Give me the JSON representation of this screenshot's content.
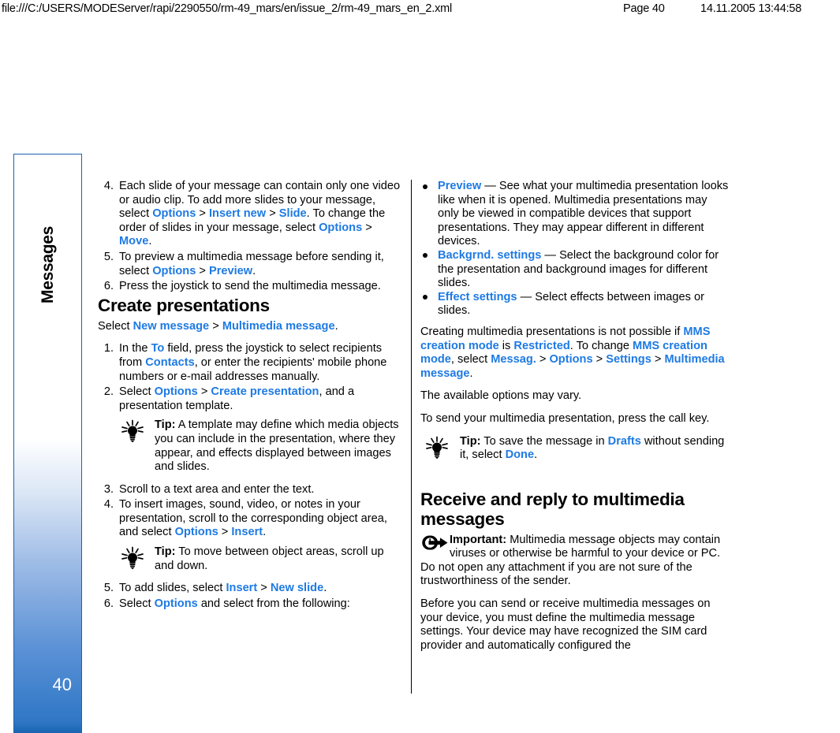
{
  "print_header": {
    "file_path": "file:///C:/USERS/MODEServer/rapi/2290550/rm-49_mars/en/issue_2/rm-49_mars_en_2.xml",
    "page_label": "Page 40",
    "timestamp": "14.11.2005 13:44:58"
  },
  "side_tab": {
    "chapter": "Messages",
    "page_number": "40",
    "border_color": "#1c63ac",
    "gradient_end_color": "#1763ae"
  },
  "colors": {
    "link_blue": "#1e7ae3",
    "text_black": "#000000",
    "page_background": "#ffffff"
  },
  "left_column": {
    "continued_steps": [
      {
        "num": "4.",
        "runs": [
          {
            "t": "Each slide of your message can contain only one video or audio clip. To add more slides to your message, select ",
            "s": "plain"
          },
          {
            "t": "Options",
            "s": "link"
          },
          {
            "t": " > ",
            "s": "gt"
          },
          {
            "t": "Insert new",
            "s": "link"
          },
          {
            "t": " > ",
            "s": "gt"
          },
          {
            "t": "Slide",
            "s": "link"
          },
          {
            "t": ". To change the order of slides in your message, select ",
            "s": "plain"
          },
          {
            "t": "Options",
            "s": "link"
          },
          {
            "t": " > ",
            "s": "gt"
          },
          {
            "t": "Move",
            "s": "link"
          },
          {
            "t": ".",
            "s": "plain"
          }
        ]
      },
      {
        "num": "5.",
        "runs": [
          {
            "t": "To preview a multimedia message before sending it, select ",
            "s": "plain"
          },
          {
            "t": "Options",
            "s": "link"
          },
          {
            "t": " > ",
            "s": "gt"
          },
          {
            "t": "Preview",
            "s": "link"
          },
          {
            "t": ".",
            "s": "plain"
          }
        ]
      },
      {
        "num": "6.",
        "runs": [
          {
            "t": "Press the joystick to send the multimedia message.",
            "s": "plain"
          }
        ]
      }
    ],
    "heading": "Create presentations",
    "intro": {
      "runs": [
        {
          "t": "Select ",
          "s": "plain"
        },
        {
          "t": "New message",
          "s": "link"
        },
        {
          "t": " > ",
          "s": "gt"
        },
        {
          "t": "Multimedia message",
          "s": "link"
        },
        {
          "t": ".",
          "s": "plain"
        }
      ]
    },
    "steps_a": [
      {
        "num": "1.",
        "runs": [
          {
            "t": "In the ",
            "s": "plain"
          },
          {
            "t": "To",
            "s": "link"
          },
          {
            "t": " field, press the joystick to select recipients from ",
            "s": "plain"
          },
          {
            "t": "Contacts",
            "s": "link"
          },
          {
            "t": ", or enter the recipients' mobile phone numbers or e-mail addresses manually.",
            "s": "plain"
          }
        ]
      },
      {
        "num": "2.",
        "runs": [
          {
            "t": "Select ",
            "s": "plain"
          },
          {
            "t": "Options",
            "s": "link"
          },
          {
            "t": " > ",
            "s": "gt"
          },
          {
            "t": "Create presentation",
            "s": "link"
          },
          {
            "t": ", and a presentation template.",
            "s": "plain"
          }
        ]
      }
    ],
    "tip_1": {
      "icon": "lightbulb-icon",
      "label": "Tip:",
      "text": " A template may define which media objects you can include in the presentation, where they appear, and effects displayed between images and slides."
    },
    "steps_b": [
      {
        "num": "3.",
        "runs": [
          {
            "t": "Scroll to a text area and enter the text.",
            "s": "plain"
          }
        ]
      },
      {
        "num": "4.",
        "runs": [
          {
            "t": "To insert images, sound, video, or notes in your presentation, scroll to the corresponding object area, and select ",
            "s": "plain"
          },
          {
            "t": "Options",
            "s": "link"
          },
          {
            "t": " > ",
            "s": "gt"
          },
          {
            "t": "Insert",
            "s": "link"
          },
          {
            "t": ".",
            "s": "plain"
          }
        ]
      }
    ],
    "tip_2": {
      "icon": "lightbulb-icon",
      "label": "Tip:",
      "text": " To move between object areas, scroll up and down."
    },
    "steps_c": [
      {
        "num": "5.",
        "runs": [
          {
            "t": "To add slides, select ",
            "s": "plain"
          },
          {
            "t": "Insert",
            "s": "link"
          },
          {
            "t": " > ",
            "s": "gt"
          },
          {
            "t": "New slide",
            "s": "link"
          },
          {
            "t": ".",
            "s": "plain"
          }
        ]
      },
      {
        "num": "6.",
        "runs": [
          {
            "t": "Select ",
            "s": "plain"
          },
          {
            "t": "Options",
            "s": "link"
          },
          {
            "t": " and select from the following:",
            "s": "plain"
          }
        ]
      }
    ]
  },
  "right_column": {
    "bullets": [
      {
        "runs": [
          {
            "t": "Preview",
            "s": "link"
          },
          {
            "t": " — See what your multimedia presentation looks like when it is opened. Multimedia presentations may only be viewed in compatible devices that support presentations. They may appear different in different devices.",
            "s": "plain"
          }
        ]
      },
      {
        "runs": [
          {
            "t": "Backgrnd. settings",
            "s": "link"
          },
          {
            "t": " — Select the background color for the presentation and background images for different slides.",
            "s": "plain"
          }
        ]
      },
      {
        "runs": [
          {
            "t": "Effect settings",
            "s": "link"
          },
          {
            "t": " — Select effects between images or slides.",
            "s": "plain"
          }
        ]
      }
    ],
    "para_creating": {
      "runs": [
        {
          "t": "Creating multimedia presentations is not possible if ",
          "s": "plain"
        },
        {
          "t": "MMS creation mode",
          "s": "link"
        },
        {
          "t": " is ",
          "s": "plain"
        },
        {
          "t": "Restricted",
          "s": "link"
        },
        {
          "t": ". To change ",
          "s": "plain"
        },
        {
          "t": "MMS creation mode",
          "s": "link"
        },
        {
          "t": ", select ",
          "s": "plain"
        },
        {
          "t": "Messag.",
          "s": "link"
        },
        {
          "t": " > ",
          "s": "gt"
        },
        {
          "t": "Options",
          "s": "link"
        },
        {
          "t": " > ",
          "s": "gt"
        },
        {
          "t": "Settings",
          "s": "link"
        },
        {
          "t": " > ",
          "s": "gt"
        },
        {
          "t": "Multimedia message",
          "s": "link"
        },
        {
          "t": ".",
          "s": "plain"
        }
      ]
    },
    "para_options_vary": "The available options may vary.",
    "para_send": "To send your multimedia presentation, press the call key.",
    "tip_3": {
      "icon": "lightbulb-icon",
      "label": "Tip:",
      "runs": [
        {
          "t": " To save the message in ",
          "s": "plain"
        },
        {
          "t": "Drafts",
          "s": "link"
        },
        {
          "t": " without sending it, select ",
          "s": "plain"
        },
        {
          "t": "Done",
          "s": "link"
        },
        {
          "t": ".",
          "s": "plain"
        }
      ]
    },
    "heading": "Receive and reply to multimedia messages",
    "important": {
      "icon": "important-arrow-icon",
      "label": "Important:",
      "text": "  Multimedia message objects may contain viruses or otherwise be harmful to your device or PC. Do not open any attachment if you are not sure of the trustworthiness of the sender."
    },
    "para_before": "Before you can send or receive multimedia messages on your device, you must define the multimedia message settings. Your device may have recognized the SIM card provider and automatically configured the"
  }
}
